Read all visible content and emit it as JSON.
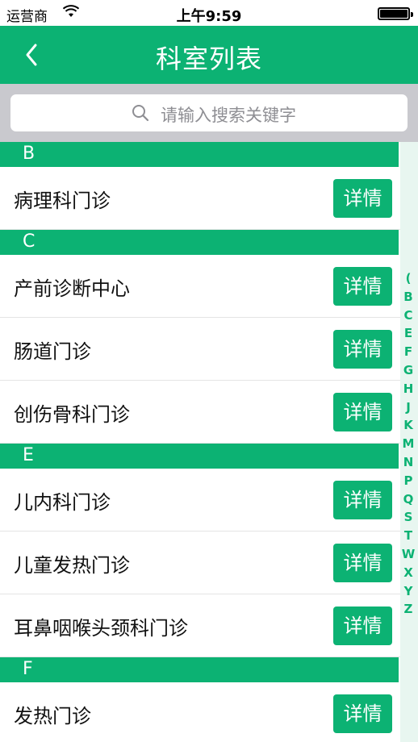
{
  "status_bar": {
    "carrier": "运营商",
    "wifi_icon": "wifi-icon",
    "time": "上午9:59",
    "battery_icon": "battery-icon"
  },
  "nav": {
    "back_icon": "chevron-left-icon",
    "title": "科室列表"
  },
  "search": {
    "icon": "search-icon",
    "placeholder": "请输入搜索关键字"
  },
  "sections": [
    {
      "letter": "B",
      "items": [
        "病理科门诊"
      ]
    },
    {
      "letter": "C",
      "items": [
        "产前诊断中心",
        "肠道门诊",
        "创伤骨科门诊"
      ]
    },
    {
      "letter": "E",
      "items": [
        "儿内科门诊",
        "儿童发热门诊",
        "耳鼻咽喉头颈科门诊"
      ]
    },
    {
      "letter": "F",
      "items": [
        "发热门诊"
      ]
    }
  ],
  "detail_button_label": "详情",
  "index_letters": [
    "(",
    "B",
    "C",
    "E",
    "F",
    "G",
    "H",
    "J",
    "K",
    "M",
    "N",
    "P",
    "Q",
    "S",
    "T",
    "W",
    "X",
    "Y",
    "Z"
  ],
  "colors": {
    "accent": "#0cb273",
    "search_bg": "#c9c9ce",
    "index_bg": "#e8f6f0"
  }
}
